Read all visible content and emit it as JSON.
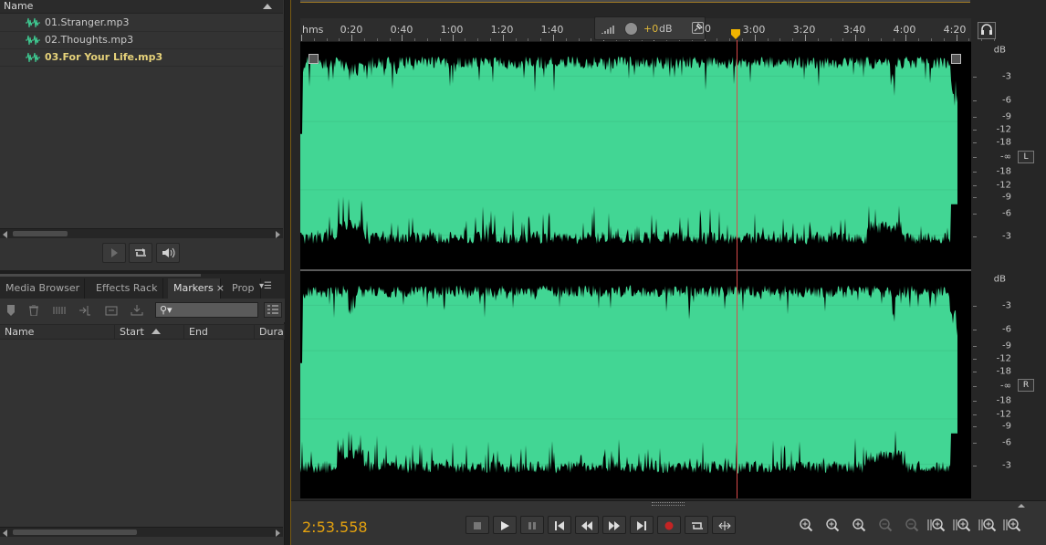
{
  "files_panel": {
    "column_name": "Name",
    "files": [
      {
        "name": "01.Stranger.mp3",
        "selected": false
      },
      {
        "name": "02.Thoughts.mp3",
        "selected": false
      },
      {
        "name": "03.For Your Life.mp3",
        "selected": true
      }
    ],
    "wave_icon_color": "#3fd397"
  },
  "markers_panel": {
    "tabs": [
      {
        "label": "Media Browser",
        "active": false
      },
      {
        "label": "Effects Rack",
        "active": false
      },
      {
        "label": "Markers",
        "active": true,
        "close": "×"
      },
      {
        "label": "Prop",
        "active": false
      }
    ],
    "search_icon": "magnifier-dropdown-icon",
    "columns": [
      "Name",
      "Start",
      "End",
      "Durat"
    ]
  },
  "editor": {
    "ruler_unit": "hms",
    "ruler_labels": [
      "0:20",
      "0:40",
      "1:00",
      "1:20",
      "1:40",
      "3:00",
      "3:20",
      "3:40",
      "4:00",
      "4:20"
    ],
    "hud_gain": "+0",
    "hud_unit": "dB",
    "hud_obscured_fragment": "0",
    "db_unit": "dB",
    "db_labels": [
      "-3",
      "-6",
      "-9",
      "-12",
      "-18",
      "-∞",
      "-18",
      "-12",
      "-9",
      "-6",
      "-3"
    ],
    "channels": [
      "L",
      "R"
    ],
    "headphone_icon": "headphones-icon",
    "waveform_color": "#42d694",
    "playhead_color": "#d84a4a",
    "accent_color": "#e4a20f"
  },
  "transport": {
    "timecode": "2:53.558",
    "buttons": [
      "stop",
      "play",
      "pause",
      "go-to-start",
      "rewind",
      "fast-forward",
      "go-to-end",
      "record",
      "loop",
      "skip-selection"
    ]
  },
  "zoom_tools": [
    "zoom-in-amplitude",
    "zoom-out-amplitude",
    "zoom-in-time",
    "zoom-out-time",
    "zoom-out-full",
    "zoom-selection-in",
    "zoom-selection-out",
    "zoom-to-left",
    "zoom-to-right"
  ]
}
